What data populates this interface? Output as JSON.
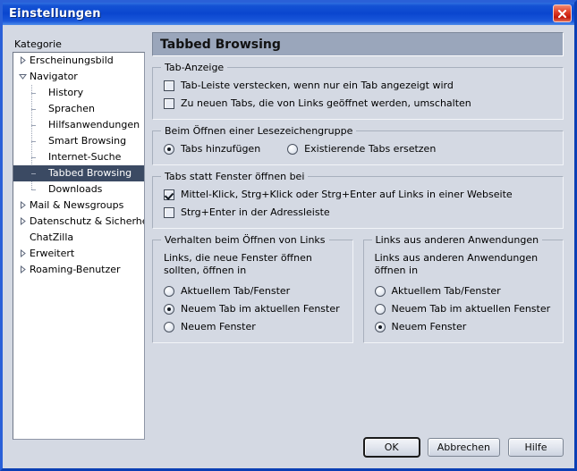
{
  "window": {
    "title": "Einstellungen",
    "close_icon": "close-icon"
  },
  "sidebar": {
    "label": "Kategorie",
    "items": [
      {
        "label": "Erscheinungsbild",
        "level": 0,
        "twisty": "collapsed",
        "selected": false
      },
      {
        "label": "Navigator",
        "level": 0,
        "twisty": "expanded",
        "selected": false
      },
      {
        "label": "History",
        "level": 1,
        "twisty": "none",
        "selected": false
      },
      {
        "label": "Sprachen",
        "level": 1,
        "twisty": "none",
        "selected": false
      },
      {
        "label": "Hilfsanwendungen",
        "level": 1,
        "twisty": "none",
        "selected": false
      },
      {
        "label": "Smart Browsing",
        "level": 1,
        "twisty": "none",
        "selected": false
      },
      {
        "label": "Internet-Suche",
        "level": 1,
        "twisty": "none",
        "selected": false
      },
      {
        "label": "Tabbed Browsing",
        "level": 1,
        "twisty": "none",
        "selected": true
      },
      {
        "label": "Downloads",
        "level": 1,
        "twisty": "none",
        "selected": false
      },
      {
        "label": "Mail & Newsgroups",
        "level": 0,
        "twisty": "collapsed",
        "selected": false
      },
      {
        "label": "Datenschutz & Sicherheit",
        "level": 0,
        "twisty": "collapsed",
        "selected": false
      },
      {
        "label": "ChatZilla",
        "level": 0,
        "twisty": "none",
        "selected": false
      },
      {
        "label": "Erweitert",
        "level": 0,
        "twisty": "collapsed",
        "selected": false
      },
      {
        "label": "Roaming-Benutzer",
        "level": 0,
        "twisty": "collapsed",
        "selected": false
      }
    ]
  },
  "panel": {
    "header": "Tabbed Browsing",
    "groups": {
      "tab_display": {
        "legend": "Tab-Anzeige",
        "checkbox_hide_tabbar": {
          "label": "Tab-Leiste verstecken, wenn nur ein Tab angezeigt wird",
          "checked": false
        },
        "checkbox_switch_to_new_tabs": {
          "label": "Zu neuen Tabs, die von Links geöffnet werden, umschalten",
          "checked": false
        }
      },
      "bookmark_group": {
        "legend": "Beim Öffnen einer Lesezeichengruppe",
        "radio_add_tabs": {
          "label": "Tabs hinzufügen",
          "checked": true
        },
        "radio_replace_tabs": {
          "label": "Existierende Tabs ersetzen",
          "checked": false
        }
      },
      "tabs_instead_windows": {
        "legend": "Tabs statt Fenster öffnen bei",
        "checkbox_middle_click": {
          "label": "Mittel-Klick, Strg+Klick oder Strg+Enter auf Links in einer Webseite",
          "checked": true
        },
        "checkbox_ctrl_enter_urlbar": {
          "label": "Strg+Enter in der Adressleiste",
          "checked": false
        }
      },
      "link_behavior": {
        "legend": "Verhalten beim Öffnen von Links",
        "intro": "Links, die neue Fenster öffnen sollten, öffnen in",
        "radios": [
          {
            "label": "Aktuellem Tab/Fenster",
            "checked": false
          },
          {
            "label": "Neuem Tab im aktuellen Fenster",
            "checked": true
          },
          {
            "label": "Neuem Fenster",
            "checked": false
          }
        ]
      },
      "external_links": {
        "legend": "Links aus anderen Anwendungen",
        "intro": "Links aus anderen Anwendungen öffnen in",
        "radios": [
          {
            "label": "Aktuellem Tab/Fenster",
            "checked": false
          },
          {
            "label": "Neuem Tab im aktuellen Fenster",
            "checked": false
          },
          {
            "label": "Neuem Fenster",
            "checked": true
          }
        ]
      }
    }
  },
  "buttons": {
    "ok": "OK",
    "cancel": "Abbrechen",
    "help": "Hilfe"
  },
  "colors": {
    "titlebar_blue": "#0a46cf",
    "window_face": "#d4d9e3",
    "panel_header": "#9aa6bb",
    "selection": "#3b4a63",
    "close_red": "#c2190b"
  }
}
